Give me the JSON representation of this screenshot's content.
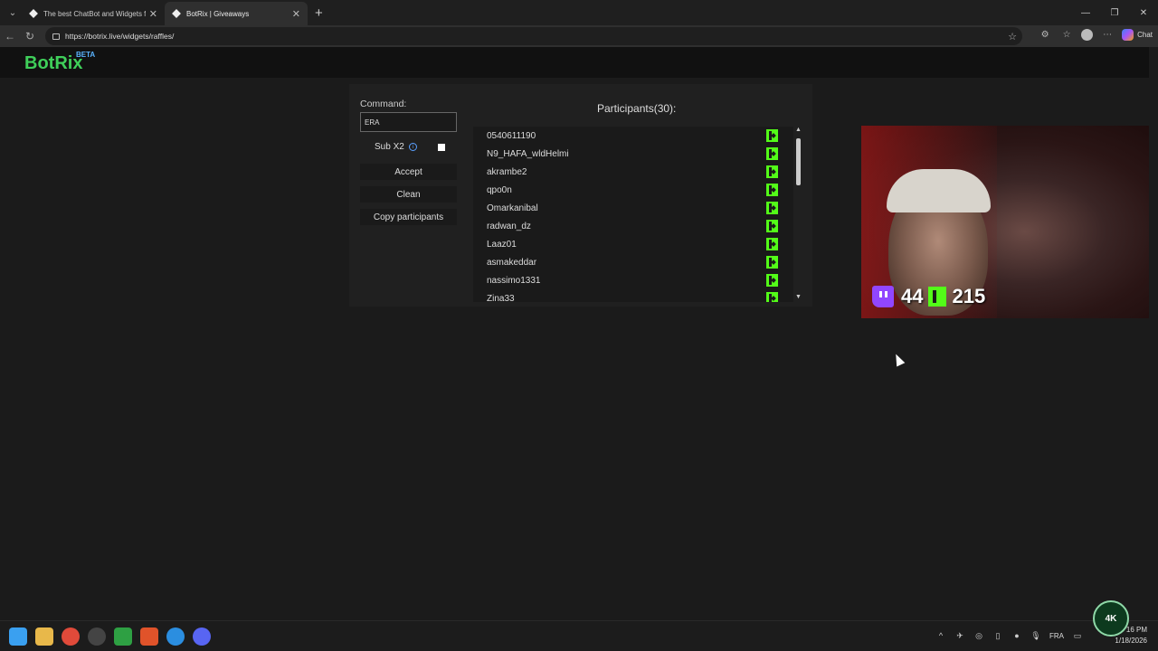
{
  "browser": {
    "tabs": [
      {
        "label": "The best ChatBot and Widgets for",
        "active": false
      },
      {
        "label": "BotRix | Giveaways",
        "active": true
      }
    ],
    "url": "https://botrix.live/widgets/raffles/",
    "chat_label": "Chat"
  },
  "header": {
    "logo": "BotRix",
    "beta": "BETA"
  },
  "widget": {
    "command_label": "Command:",
    "command_value": "ERA",
    "subx2_label": "Sub X2",
    "subx2_checked": false,
    "accept_label": "Accept",
    "clean_label": "Clean",
    "copy_label": "Copy participants",
    "participants_title": "Participants(30):",
    "participants": [
      "0540611190",
      "N9_HAFA_wldHelmi",
      "akrambe2",
      "qpo0n",
      "Omarkanibal",
      "radwan_dz",
      "Laaz01",
      "asmakeddar",
      "nassimo1331",
      "Zina33"
    ]
  },
  "overlay": {
    "twitch_count": "44",
    "kick_count": "215",
    "twitch_color": "#9146ff",
    "kick_color": "#53fc18"
  },
  "taskbar": {
    "lang": "FRA",
    "time": "16 PM",
    "date": "1/18/2026",
    "badge": "4K"
  }
}
